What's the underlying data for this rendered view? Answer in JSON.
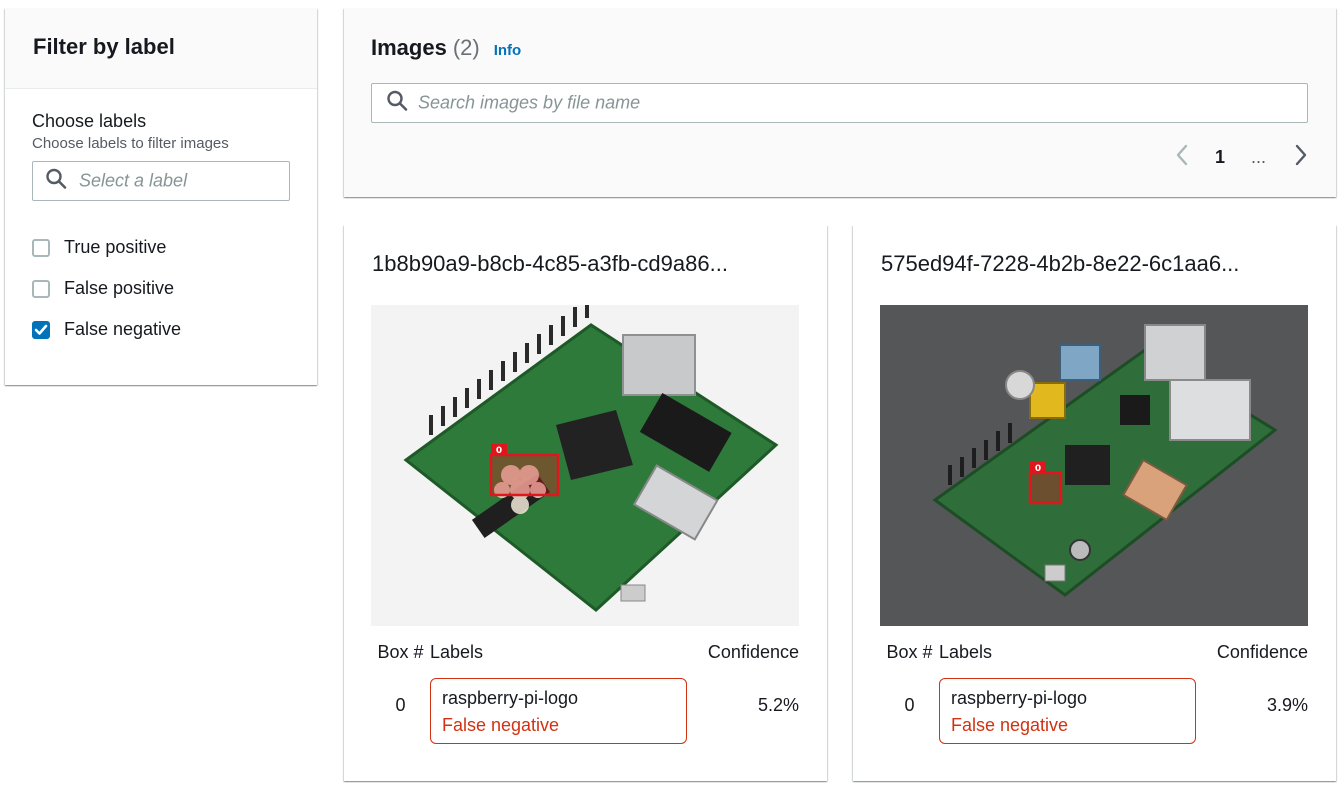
{
  "filter": {
    "title": "Filter by label",
    "field_label": "Choose labels",
    "field_description": "Choose labels to filter images",
    "select_placeholder": "Select a label",
    "options": [
      {
        "label": "True positive",
        "checked": false
      },
      {
        "label": "False positive",
        "checked": false
      },
      {
        "label": "False negative",
        "checked": true
      }
    ]
  },
  "images": {
    "title": "Images",
    "count": "(2)",
    "info_link": "Info",
    "search_placeholder": "Search images by file name",
    "pagination": {
      "current_page": "1",
      "ellipsis": "..."
    }
  },
  "table_headers": {
    "box": "Box #",
    "labels": "Labels",
    "confidence": "Confidence"
  },
  "cards": [
    {
      "file_name": "1b8b90a9-b8cb-4c85-a3fb-cd9a86...",
      "image": "raspberry-pi-zero-board-photo",
      "box_tag": "0",
      "rows": [
        {
          "box": "0",
          "label": "raspberry-pi-logo",
          "status": "False negative",
          "confidence": "5.2%"
        }
      ]
    },
    {
      "file_name": "575ed94f-7228-4b2b-8e22-6c1aa6...",
      "image": "raspberry-pi-model-b-board-photo",
      "box_tag": "0",
      "rows": [
        {
          "box": "0",
          "label": "raspberry-pi-logo",
          "status": "False negative",
          "confidence": "3.9%"
        }
      ]
    }
  ],
  "colors": {
    "accent": "#0073bb",
    "error": "#d13212",
    "bounding_box": "#e0161c"
  }
}
